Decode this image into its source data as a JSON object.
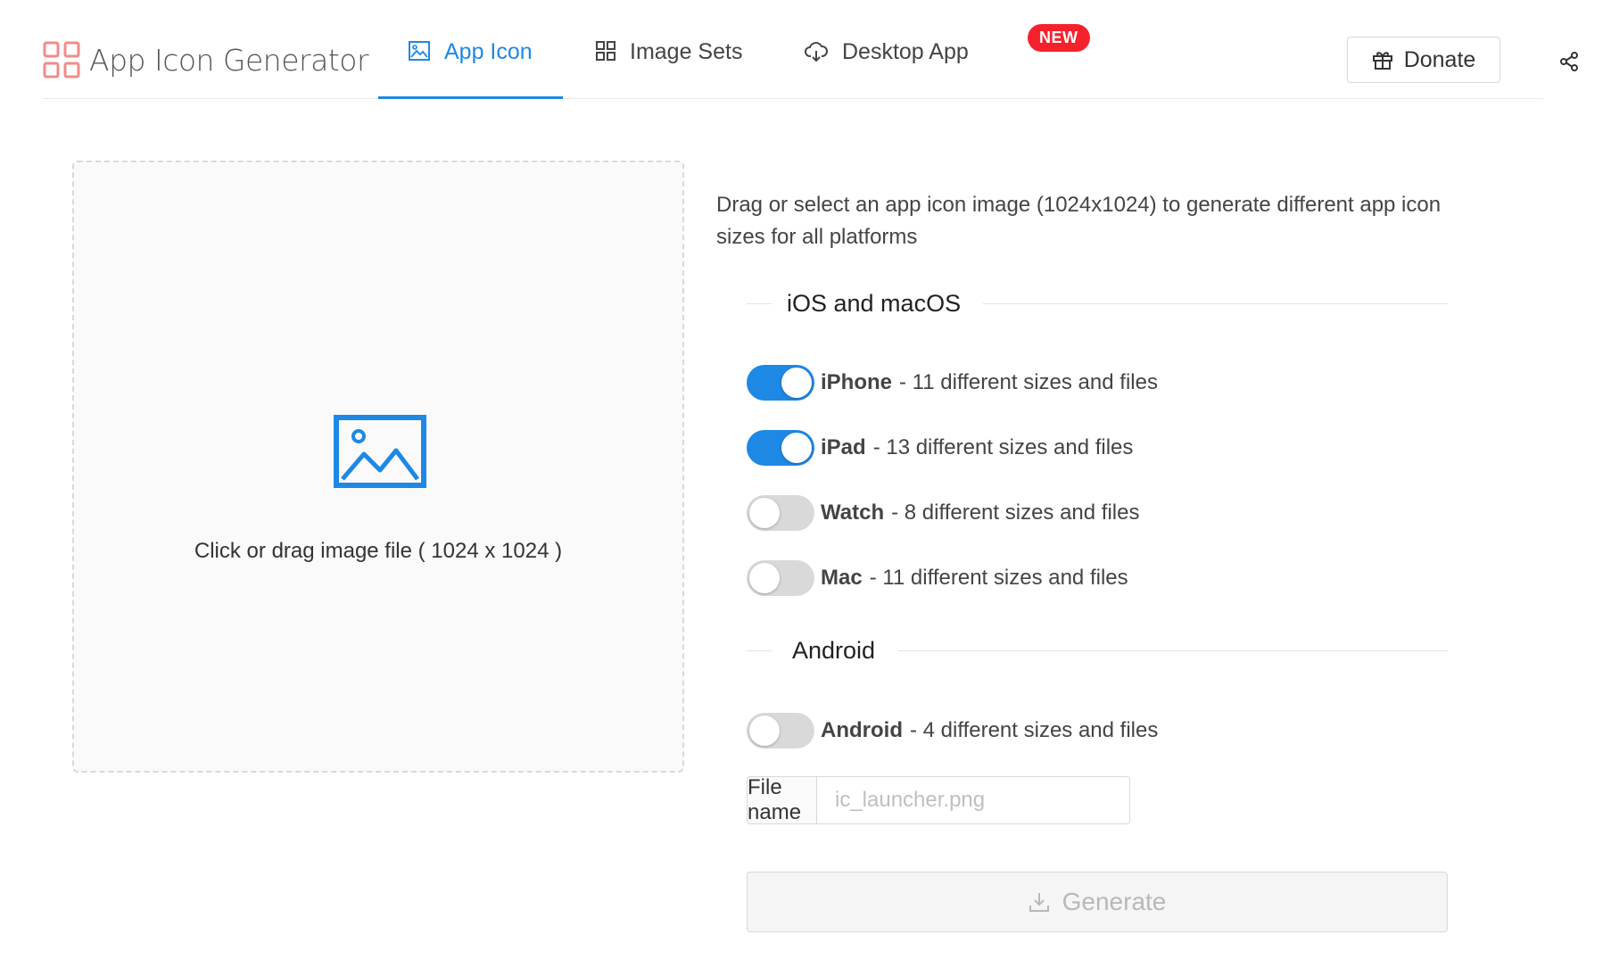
{
  "header": {
    "app_title": "App Icon Generator",
    "tabs": [
      {
        "label": "App Icon",
        "icon": "image-icon",
        "active": true
      },
      {
        "label": "Image Sets",
        "icon": "grid-icon",
        "active": false
      },
      {
        "label": "Desktop App",
        "icon": "cloud-download-icon",
        "active": false
      }
    ],
    "new_badge": "NEW",
    "donate_label": "Donate",
    "share_icon": "share-icon"
  },
  "dropzone": {
    "icon": "image-icon",
    "text": "Click or drag image file ( 1024 x 1024 )"
  },
  "panel": {
    "description": "Drag or select an app icon image (1024x1024) to generate different app icon sizes for all platforms",
    "sections": [
      {
        "title": "iOS and macOS",
        "options": [
          {
            "name": "iPhone",
            "detail": "- 11 different sizes and files",
            "enabled": true
          },
          {
            "name": "iPad",
            "detail": "- 13 different sizes and files",
            "enabled": true
          },
          {
            "name": "Watch",
            "detail": "- 8 different sizes and files",
            "enabled": false
          },
          {
            "name": "Mac",
            "detail": "- 11 different sizes and files",
            "enabled": false
          }
        ]
      },
      {
        "title": "Android",
        "options": [
          {
            "name": "Android",
            "detail": "- 4 different sizes and files",
            "enabled": false
          }
        ]
      }
    ],
    "file_name": {
      "label": "File name",
      "value": "",
      "placeholder": "ic_launcher.png"
    },
    "generate_label": "Generate"
  },
  "colors": {
    "accent": "#1e88e5",
    "badge": "#f5222d",
    "logo": "#f28b8b"
  }
}
